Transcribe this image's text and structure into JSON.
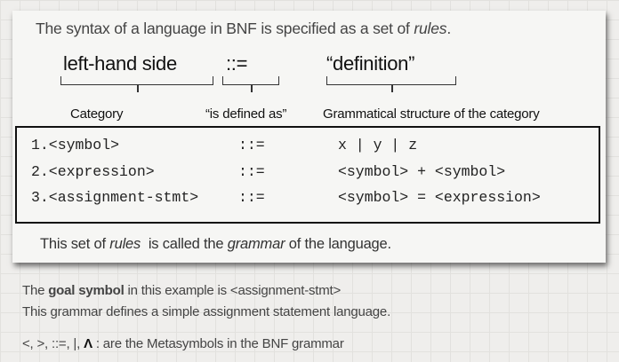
{
  "slide": {
    "intro": {
      "pre": "The syntax of a language in BNF is specified as a set of ",
      "em": "rules",
      "post": "."
    },
    "parts": [
      {
        "head": "left-hand side",
        "label": "Category"
      },
      {
        "head": "::=",
        "label": "“is defined as”"
      },
      {
        "head": "“definition”",
        "label": "Grammatical structure of the category"
      }
    ],
    "rules": [
      {
        "lhs": "1.<symbol>",
        "op": "::=",
        "rhs": "x | y | z"
      },
      {
        "lhs": "2.<expression>",
        "op": "::=",
        "rhs": "<symbol> + <symbol>"
      },
      {
        "lhs": "3.<assignment-stmt>",
        "op": "::=",
        "rhs": "<symbol> = <expression>"
      }
    ],
    "footer": {
      "pre": "This set of ",
      "em1": "rules",
      "mid": "  is called the ",
      "em2": "grammar",
      "post": " of the language."
    }
  },
  "notes": {
    "line1": {
      "pre": "The ",
      "bold": "goal symbol",
      "post": " in this example is <assignment-stmt>"
    },
    "line2": "This grammar defines a simple assignment statement language.",
    "line3": {
      "pre": "<, >, ::=, |, ",
      "bold": "Λ",
      "post": " : are the Metasymbols in the BNF grammar"
    }
  }
}
